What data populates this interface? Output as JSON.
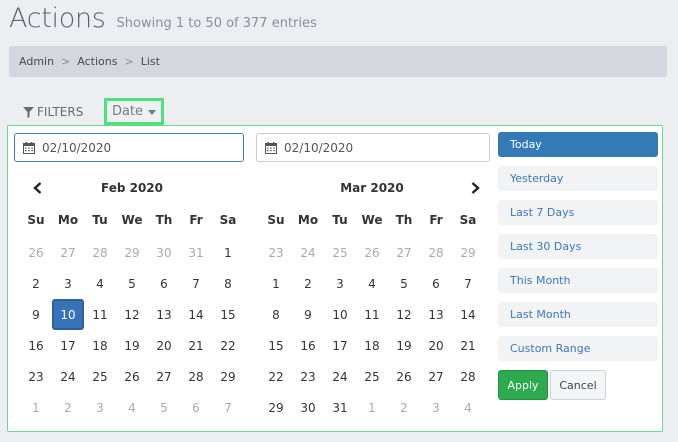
{
  "header": {
    "title": "Actions",
    "subtitle": "Showing 1 to 50 of 377 entries"
  },
  "breadcrumb": [
    "Admin",
    "Actions",
    "List"
  ],
  "toolbar": {
    "filters_label": "FILTERS",
    "date_label": "Date"
  },
  "picker": {
    "start_value": "02/10/2020",
    "end_value": "02/10/2020",
    "weekdays": [
      "Su",
      "Mo",
      "Tu",
      "We",
      "Th",
      "Fr",
      "Sa"
    ],
    "left_calendar": {
      "title": "Feb 2020",
      "days": [
        [
          "26",
          "27",
          "28",
          "29",
          "30",
          "31",
          "1"
        ],
        [
          "2",
          "3",
          "4",
          "5",
          "6",
          "7",
          "8"
        ],
        [
          "9",
          "10",
          "11",
          "12",
          "13",
          "14",
          "15"
        ],
        [
          "16",
          "17",
          "18",
          "19",
          "20",
          "21",
          "22"
        ],
        [
          "23",
          "24",
          "25",
          "26",
          "27",
          "28",
          "29"
        ],
        [
          "1",
          "2",
          "3",
          "4",
          "5",
          "6",
          "7"
        ]
      ],
      "off": [
        [
          0,
          0
        ],
        [
          0,
          1
        ],
        [
          0,
          2
        ],
        [
          0,
          3
        ],
        [
          0,
          4
        ],
        [
          0,
          5
        ],
        [
          5,
          0
        ],
        [
          5,
          1
        ],
        [
          5,
          2
        ],
        [
          5,
          3
        ],
        [
          5,
          4
        ],
        [
          5,
          5
        ],
        [
          5,
          6
        ]
      ],
      "selected": [
        2,
        1
      ]
    },
    "right_calendar": {
      "title": "Mar 2020",
      "days": [
        [
          "23",
          "24",
          "25",
          "26",
          "27",
          "28",
          "29"
        ],
        [
          "1",
          "2",
          "3",
          "4",
          "5",
          "6",
          "7"
        ],
        [
          "8",
          "9",
          "10",
          "11",
          "12",
          "13",
          "14"
        ],
        [
          "15",
          "16",
          "17",
          "18",
          "19",
          "20",
          "21"
        ],
        [
          "22",
          "23",
          "24",
          "25",
          "26",
          "27",
          "28"
        ],
        [
          "29",
          "30",
          "31",
          "1",
          "2",
          "3",
          "4"
        ]
      ],
      "off": [
        [
          0,
          0
        ],
        [
          0,
          1
        ],
        [
          0,
          2
        ],
        [
          0,
          3
        ],
        [
          0,
          4
        ],
        [
          0,
          5
        ],
        [
          0,
          6
        ],
        [
          5,
          3
        ],
        [
          5,
          4
        ],
        [
          5,
          5
        ],
        [
          5,
          6
        ]
      ],
      "selected": null
    },
    "ranges": [
      "Today",
      "Yesterday",
      "Last 7 Days",
      "Last 30 Days",
      "This Month",
      "Last Month",
      "Custom Range"
    ],
    "active_range": 0,
    "apply_label": "Apply",
    "cancel_label": "Cancel"
  },
  "colors": {
    "accent": "#337ab7",
    "apply": "#2eaa4e",
    "highlight": "#4ee07a"
  }
}
